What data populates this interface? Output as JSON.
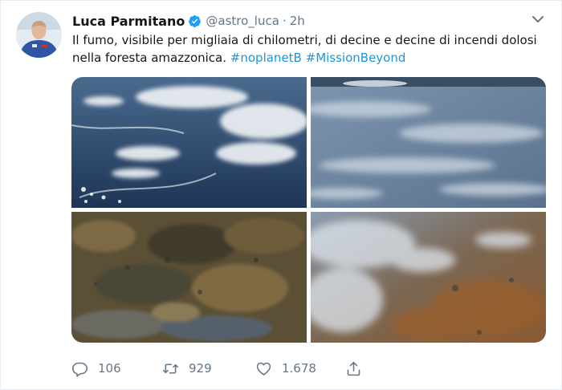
{
  "tweet": {
    "author_name": "Luca Parmitano",
    "handle": "@astro_luca",
    "separator": "·",
    "time": "2h",
    "text_main": "Il fumo, visibile per migliaia di chilometri, di decine e decine di incendi dolosi nella foresta amazzonica.",
    "hashtags": [
      "#noplanetB",
      "#MissionBeyond"
    ],
    "verified": true,
    "media": [
      "smoke-over-clouds-photo",
      "hazy-smoke-cover-photo",
      "forest-terrain-photo",
      "fire-smoke-plumes-photo"
    ],
    "actions": {
      "reply_count": "106",
      "retweet_count": "929",
      "like_count": "1.678"
    }
  },
  "colors": {
    "accent": "#1b95e0",
    "muted": "#657786",
    "verified": "#1da1f2"
  },
  "icons": [
    "caret-down-icon",
    "verified-badge-icon",
    "reply-icon",
    "retweet-icon",
    "like-icon",
    "share-icon"
  ]
}
